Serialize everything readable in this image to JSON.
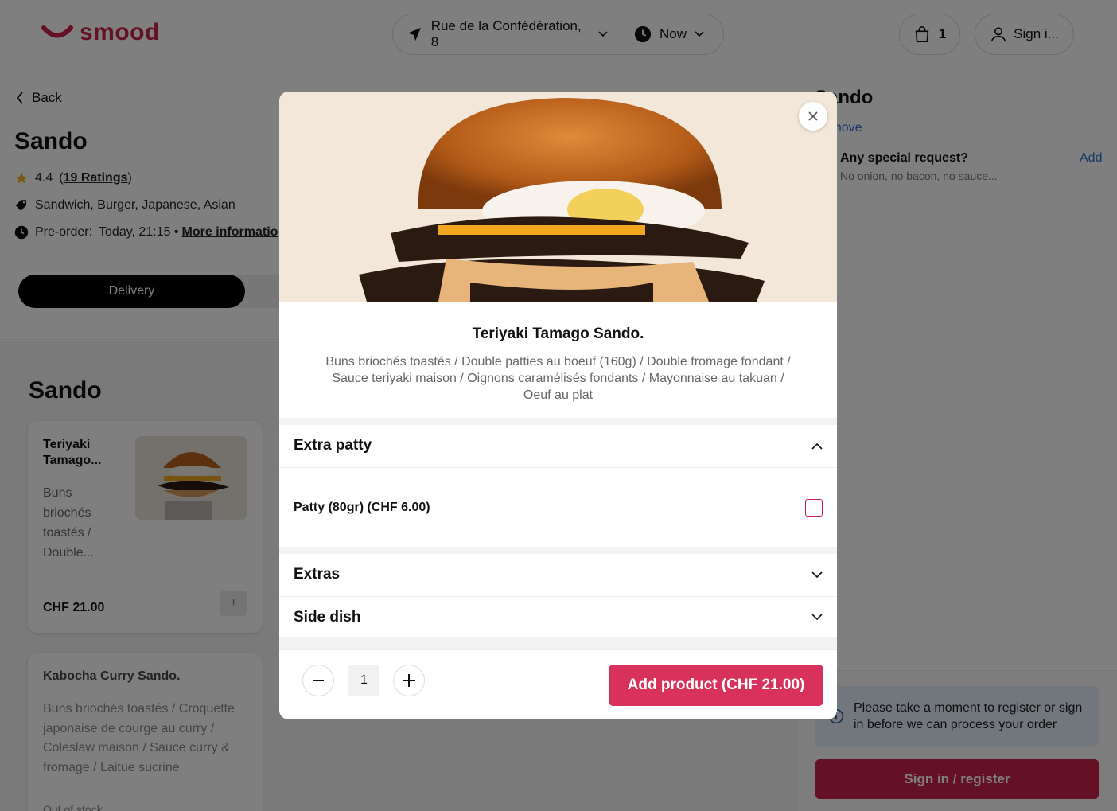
{
  "header": {
    "logo_text": "smood",
    "address": "Rue de la Confédération, 8",
    "time": "Now",
    "cart_count": "1",
    "signin_label": "Sign i..."
  },
  "restaurant": {
    "back_label": "Back",
    "name": "Sando",
    "rating": "4.4",
    "ratings_link": "19 Ratings",
    "cuisines": "Sandwich, Burger, Japanese, Asian",
    "preorder_label": "Pre-order:",
    "preorder_time": "Today, 21:15 •",
    "more_info": "More informatio",
    "delivery_label": "Delivery"
  },
  "menu": {
    "section_title": "Sando",
    "items": [
      {
        "name": "Teriyaki Tamago...",
        "desc": "Buns briochés toastés / Double...",
        "price": "CHF 21.00",
        "add": "+"
      },
      {
        "name": "Kabocha Curry Sando.",
        "desc": "Buns briochés toastés / Croquette japonaise de courge au curry / Coleslaw maison / Sauce curry & fromage / Laitue sucrine",
        "status": "Out of stock"
      }
    ]
  },
  "cart": {
    "title": "Sando",
    "remove": "Remove",
    "special_request": "Any special request?",
    "special_request_hint": "No onion, no bacon, no sauce...",
    "add_label": "Add",
    "notice": "Please take a moment to register or sign in before we can process your order",
    "signin_button": "Sign in / register"
  },
  "modal": {
    "title": "Teriyaki Tamago Sando.",
    "description": "Buns briochés toastés / Double patties au boeuf (160g) / Double fromage fondant / Sauce teriyaki maison / Oignons caramélisés fondants / Mayonnaise au takuan / Oeuf au plat",
    "sections": [
      {
        "title": "Extra patty",
        "expanded": true
      },
      {
        "title": "Extras",
        "expanded": false
      },
      {
        "title": "Side dish",
        "expanded": false
      }
    ],
    "option_label": "Patty (80gr) (CHF 6.00)",
    "quantity": "1",
    "add_button": "Add product (CHF 21.00)"
  },
  "colors": {
    "brand": "#c8234d",
    "link": "#2f6fd0"
  }
}
